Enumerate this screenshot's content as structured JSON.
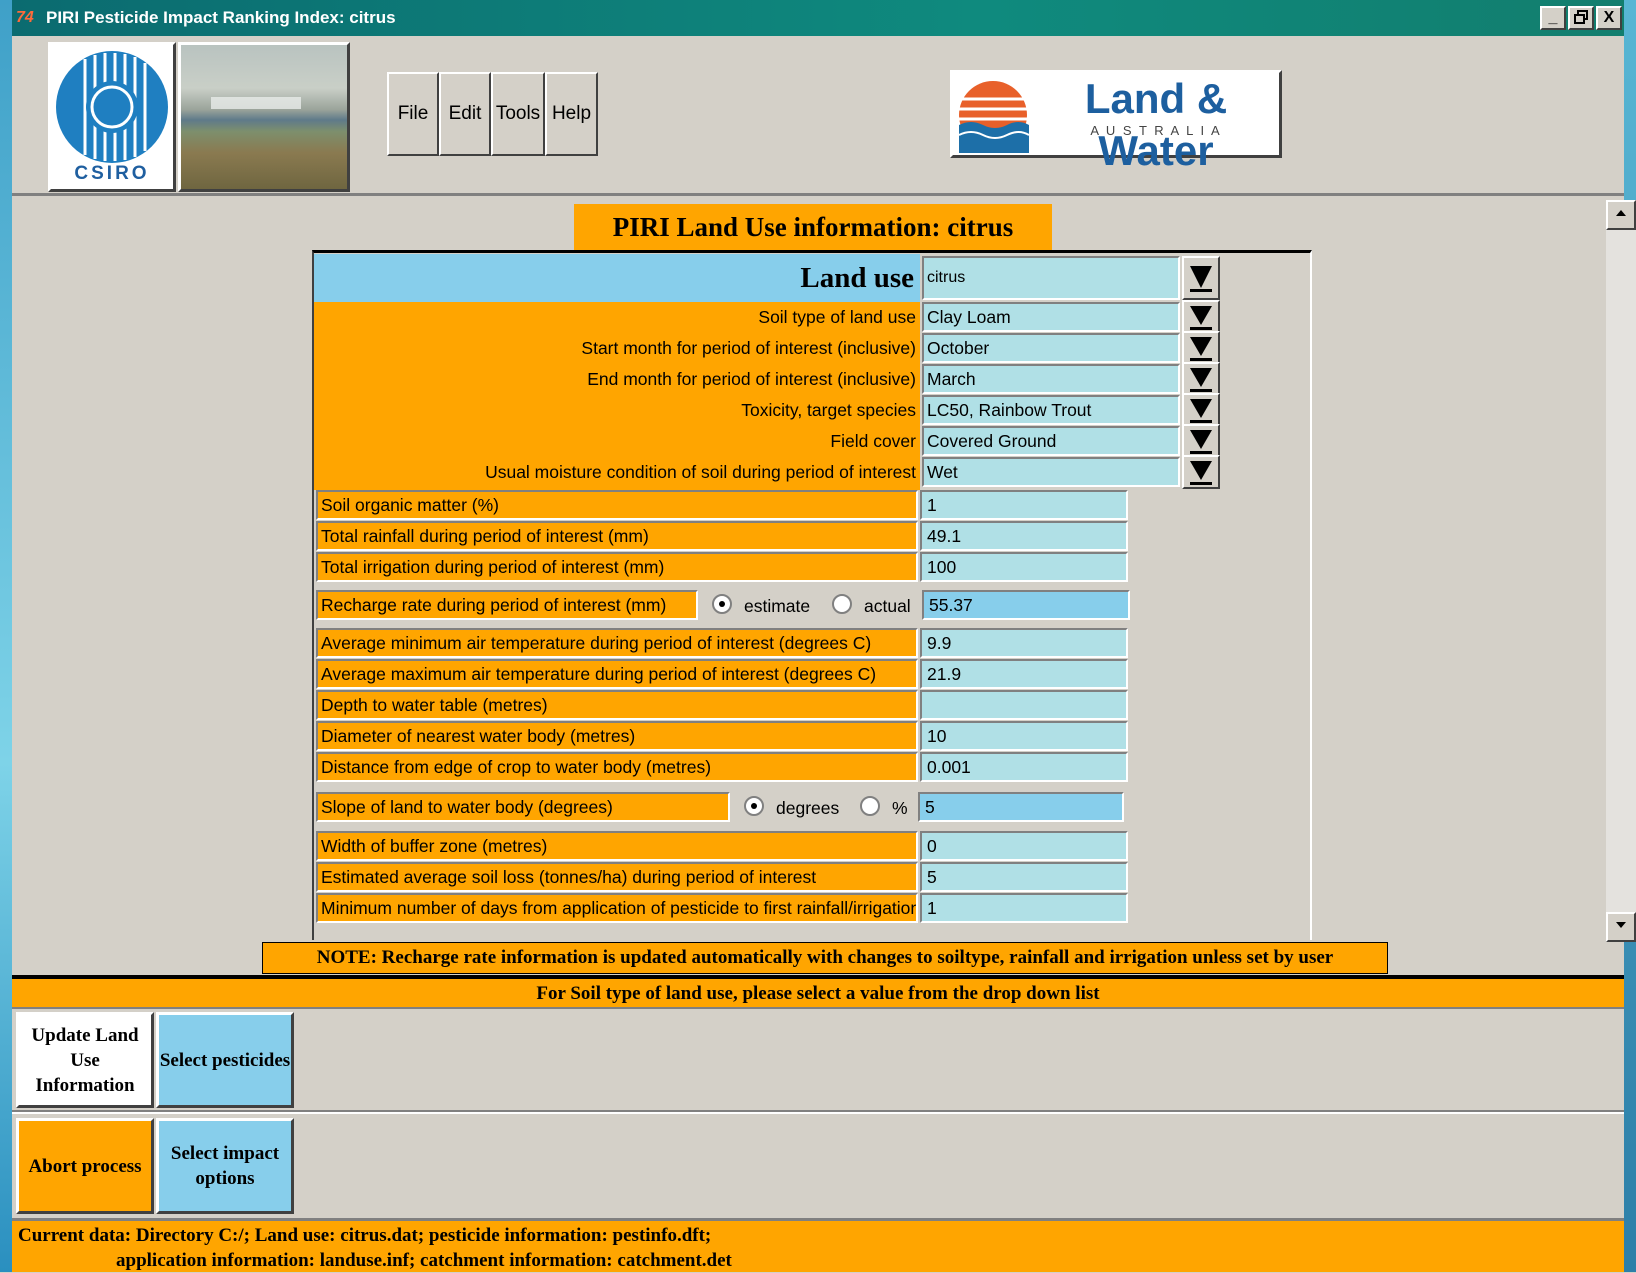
{
  "window": {
    "title": "PIRI Pesticide Impact Ranking Index: citrus",
    "icon_text": "74",
    "controls": [
      "_",
      "🗗",
      "X"
    ]
  },
  "header": {
    "csiro_text": "CSIRO",
    "menu": [
      "File",
      "Edit",
      "Tools",
      "Help"
    ],
    "lw_logo": {
      "main": "Land & Water",
      "sub": "A U S T R A L I A"
    }
  },
  "form": {
    "heading": "PIRI Land Use information: citrus",
    "land_use": {
      "label": "Land use",
      "value": "citrus"
    },
    "dropdowns": [
      {
        "label": "Soil type of land use",
        "value": "Clay Loam"
      },
      {
        "label": "Start month for period of interest (inclusive)",
        "value": "October"
      },
      {
        "label": "End month for period of interest (inclusive)",
        "value": "March"
      },
      {
        "label": "Toxicity, target species",
        "value": "LC50, Rainbow Trout"
      },
      {
        "label": "Field cover",
        "value": "Covered Ground"
      },
      {
        "label": "Usual moisture condition of soil during period of interest",
        "value": "Wet"
      }
    ],
    "fields_a": [
      {
        "label": "Soil organic matter (%)",
        "value": "1"
      },
      {
        "label": "Total rainfall during period of interest (mm)",
        "value": "49.1"
      },
      {
        "label": "Total irrigation during period of interest (mm)",
        "value": "100"
      }
    ],
    "recharge": {
      "label": "Recharge rate during period of interest (mm)",
      "opt1": "estimate",
      "opt2": "actual",
      "value": "55.37",
      "selected": "estimate"
    },
    "fields_b": [
      {
        "label": "Average minimum air temperature during period of interest (degrees C)",
        "value": "9.9"
      },
      {
        "label": "Average maximum air temperature during period of interest (degrees C)",
        "value": "21.9"
      },
      {
        "label": "Depth to water table (metres)",
        "value": ""
      },
      {
        "label": "Diameter of nearest water body (metres)",
        "value": "10"
      },
      {
        "label": "Distance from edge of crop to water body (metres)",
        "value": "0.001"
      }
    ],
    "slope": {
      "label": "Slope of land to water body (degrees)",
      "opt1": "degrees",
      "opt2": "%",
      "value": "5",
      "selected": "degrees"
    },
    "fields_c": [
      {
        "label": "Width of buffer zone (metres)",
        "value": "0"
      },
      {
        "label": "Estimated average soil loss (tonnes/ha) during period of interest",
        "value": "5"
      },
      {
        "label": "Minimum number of days from application of pesticide to first rainfall/irrigation",
        "value": "1"
      }
    ]
  },
  "note": "NOTE: Recharge rate information is updated automatically with changes to soiltype, rainfall and irrigation unless set by user",
  "status_message": "For Soil type of land use, please select a value from the drop down list",
  "buttons": {
    "update": "Update Land Use Information",
    "select_pesticides": "Select pesticides",
    "abort": "Abort process",
    "select_impact": "Select impact options"
  },
  "current_data": {
    "line1": "Current data: Directory C:/;  Land use: citrus.dat; pesticide information:  pestinfo.dft;",
    "line2": "application information: landuse.inf; catchment information: catchment.det"
  },
  "colors": {
    "orange": "#ffa500",
    "sky": "#87ceeb",
    "field": "#b0e0e6",
    "titlebar": "#0f8a7e"
  }
}
